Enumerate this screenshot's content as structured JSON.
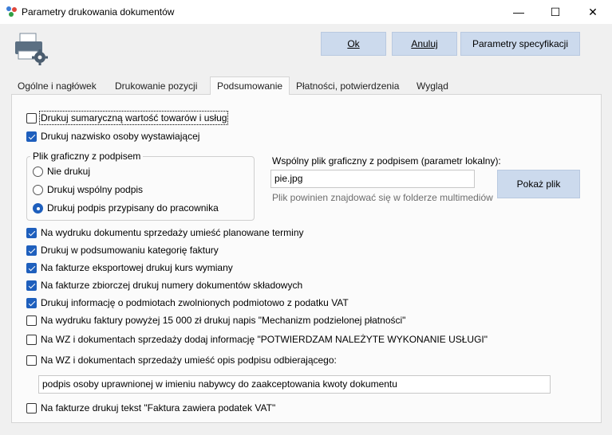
{
  "window": {
    "title": "Parametry drukowania dokumentów",
    "controls": {
      "minimize": "—",
      "maximize": "☐",
      "close": "✕"
    }
  },
  "toolbar": {
    "ok_label": "Ok",
    "cancel_label": "Anuluj",
    "spec_label": "Parametry specyfikacji"
  },
  "tabs": [
    {
      "label": "Ogólne i nagłówek",
      "active": false
    },
    {
      "label": "Drukowanie pozycji",
      "active": false
    },
    {
      "label": "Podsumowanie",
      "active": true
    },
    {
      "label": "Płatności, potwierdzenia",
      "active": false
    },
    {
      "label": "Wygląd",
      "active": false
    }
  ],
  "summary": {
    "print_total": {
      "label": "Drukuj sumaryczną wartość towarów i usług",
      "checked": false
    },
    "print_issuer": {
      "label": "Drukuj nazwisko osoby wystawiającej",
      "checked": true
    }
  },
  "signature_group": {
    "title": "Plik graficzny z podpisem",
    "options": [
      {
        "label": "Nie drukuj",
        "selected": false
      },
      {
        "label": "Drukuj wspólny podpis",
        "selected": false
      },
      {
        "label": "Drukuj podpis przypisany do pracownika",
        "selected": true
      }
    ]
  },
  "shared_signature": {
    "label": "Wspólny plik graficzny z podpisem (parametr lokalny):",
    "value": "pie.jpg",
    "hint": "Plik powinien znajdować się w folderze multimediów",
    "show_button": "Pokaż plik"
  },
  "options": [
    {
      "label": "Na wydruku dokumentu sprzedaży umieść planowane terminy",
      "checked": true
    },
    {
      "label": "Drukuj w podsumowaniu kategorię faktury",
      "checked": true
    },
    {
      "label": "Na fakturze eksportowej drukuj kurs wymiany",
      "checked": true
    },
    {
      "label": "Na fakturze zbiorczej drukuj numery dokumentów składowych",
      "checked": true
    },
    {
      "label": "Drukuj informację o podmiotach zwolnionych podmiotowo z podatku VAT",
      "checked": true
    },
    {
      "label": "Na wydruku faktury powyżej 15 000 zł drukuj napis \"Mechanizm podzielonej płatności\"",
      "checked": false
    },
    {
      "label": "Na WZ i dokumentach sprzedaży dodaj informację \"POTWIERDZAM NALEŻYTE WYKONANIE USŁUGI\"",
      "checked": false
    },
    {
      "label": "Na WZ i dokumentach sprzedaży umieść opis podpisu odbierającego:",
      "checked": false
    }
  ],
  "receiver_signature_text": "podpis osoby uprawnionej w imieniu nabywcy do zaakceptowania kwoty dokumentu",
  "vat_text_option": {
    "label": "Na fakturze drukuj tekst \"Faktura zawiera podatek VAT\"",
    "checked": false
  },
  "colors": {
    "accent": "#1e5fbd",
    "button_bg": "#ccdaed"
  }
}
